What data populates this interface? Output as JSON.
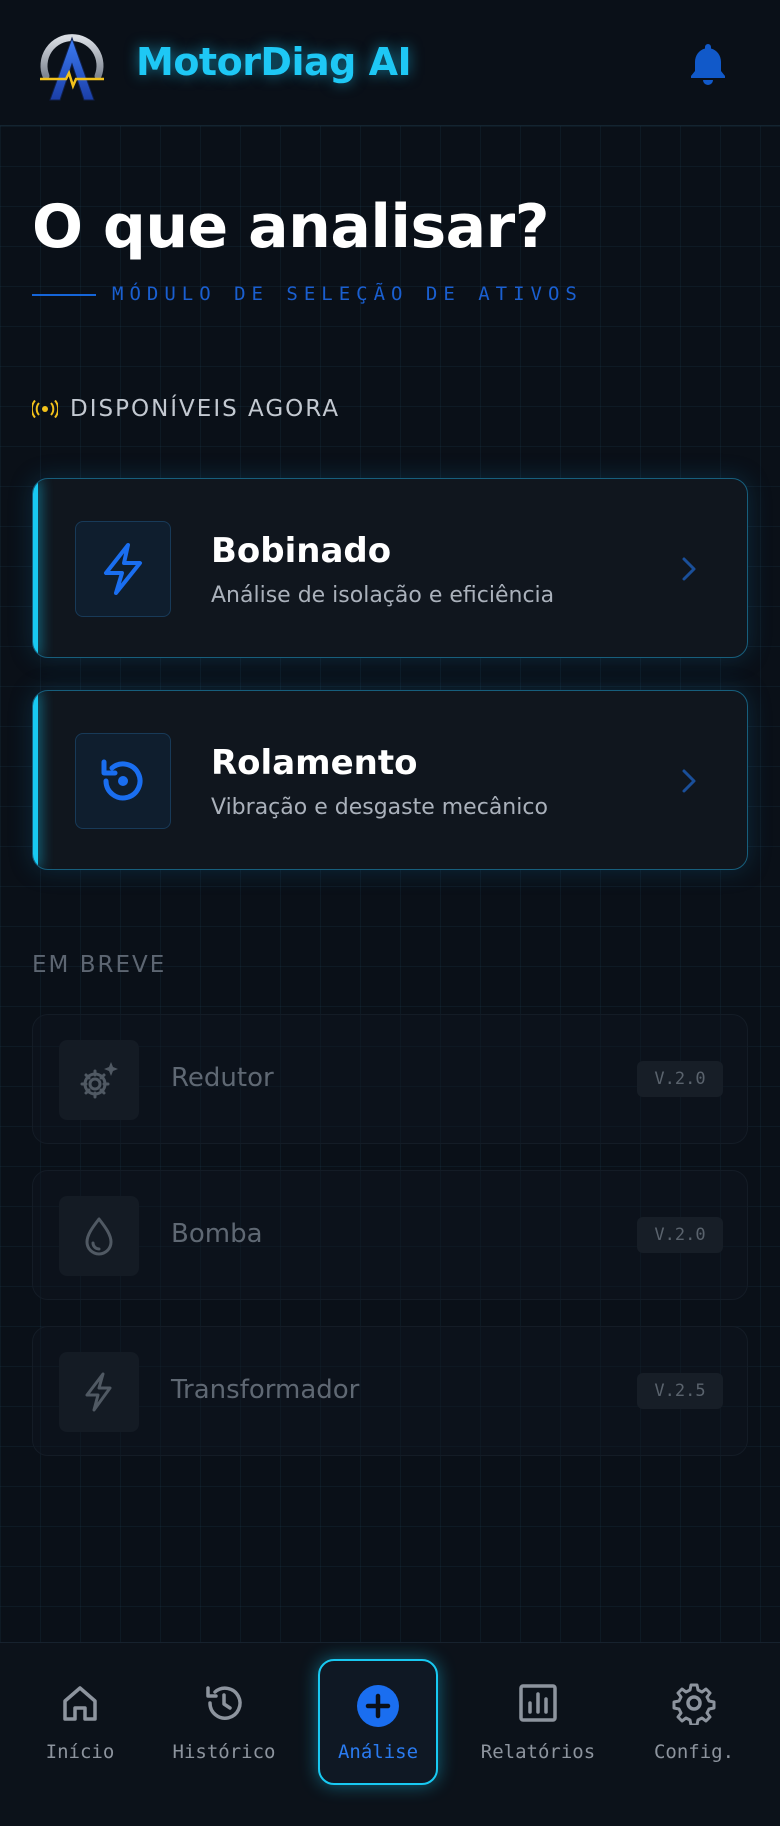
{
  "header": {
    "app_title": "MotorDiag AI",
    "logo_icon": "motordiag-logo-icon",
    "notification_icon": "bell-icon"
  },
  "page": {
    "title": "O que analisar?",
    "subtitle": "MÓDULO DE SELEÇÃO DE ATIVOS"
  },
  "available": {
    "label": "DISPONÍVEIS AGORA",
    "icon": "broadcast-icon",
    "items": [
      {
        "title": "Bobinado",
        "description": "Análise de isolação e eficiência",
        "icon": "lightning-icon"
      },
      {
        "title": "Rolamento",
        "description": "Vibração e desgaste mecânico",
        "icon": "rotate-icon"
      }
    ]
  },
  "coming_soon": {
    "label": "EM BREVE",
    "items": [
      {
        "title": "Redutor",
        "version": "V.2.0",
        "icon": "gear-sparkle-icon"
      },
      {
        "title": "Bomba",
        "version": "V.2.0",
        "icon": "water-drop-icon"
      },
      {
        "title": "Transformador",
        "version": "V.2.5",
        "icon": "bolt-outline-icon"
      }
    ]
  },
  "nav": {
    "items": [
      {
        "label": "Início",
        "icon": "home-icon"
      },
      {
        "label": "Histórico",
        "icon": "history-icon"
      },
      {
        "label": "Análise",
        "icon": "plus-circle-icon",
        "active": true
      },
      {
        "label": "Relatórios",
        "icon": "bar-chart-icon"
      },
      {
        "label": "Config.",
        "icon": "gear-icon"
      }
    ]
  },
  "colors": {
    "accent_cyan": "#18c9f2",
    "accent_blue": "#1565d8",
    "background": "#0a1018",
    "signal_yellow": "#f2c21b"
  }
}
